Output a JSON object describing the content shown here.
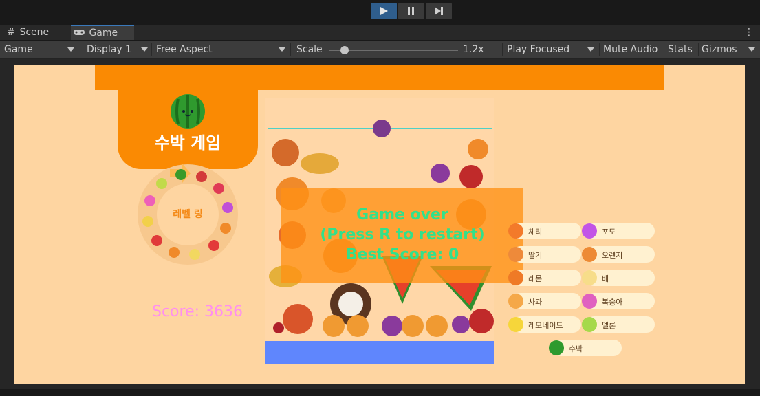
{
  "playbar": {
    "play_icon": "play-icon",
    "pause_icon": "pause-icon",
    "step_icon": "step-icon"
  },
  "tabs": [
    {
      "label": "Scene",
      "icon": "grid-icon"
    },
    {
      "label": "Game",
      "icon": "gamepad-icon"
    }
  ],
  "toolbar": {
    "game_select": "Game",
    "display_select": "Display 1",
    "aspect_select": "Free Aspect",
    "scale_label": "Scale",
    "scale_value": "1.2x",
    "scale_fraction": 0.12,
    "play_focused": "Play Focused",
    "mute_audio": "Mute Audio",
    "stats": "Stats",
    "gizmos": "Gizmos"
  },
  "game": {
    "title": "수박 게임",
    "ring_label": "레벨 링",
    "score": "Score: 3636",
    "overlay": {
      "line1": "Game over",
      "line2": "(Press R to restart)",
      "line3": "Best Score: 0"
    },
    "legend": [
      {
        "name": "체리",
        "color": "#f37a2a"
      },
      {
        "name": "포도",
        "color": "#c254e6"
      },
      {
        "name": "딸기",
        "color": "#ee8a3a"
      },
      {
        "name": "오렌지",
        "color": "#ed8a35"
      },
      {
        "name": "레몬",
        "color": "#ef7a26"
      },
      {
        "name": "배",
        "color": "#f7dd8a"
      },
      {
        "name": "사과",
        "color": "#f5a848"
      },
      {
        "name": "복숭아",
        "color": "#e060c0"
      },
      {
        "name": "레모네이드",
        "color": "#f6d63a"
      },
      {
        "name": "멜론",
        "color": "#a6d94a"
      },
      {
        "name": "수박",
        "color": "#2e9a2e"
      }
    ]
  },
  "colors": {
    "accent": "#2f5e8d",
    "orange": "#fa8a03",
    "background": "#fed5a1",
    "score": "#ff8ef0",
    "overlay_text": "#33e08a",
    "blue_floor": "#5f86fd"
  }
}
